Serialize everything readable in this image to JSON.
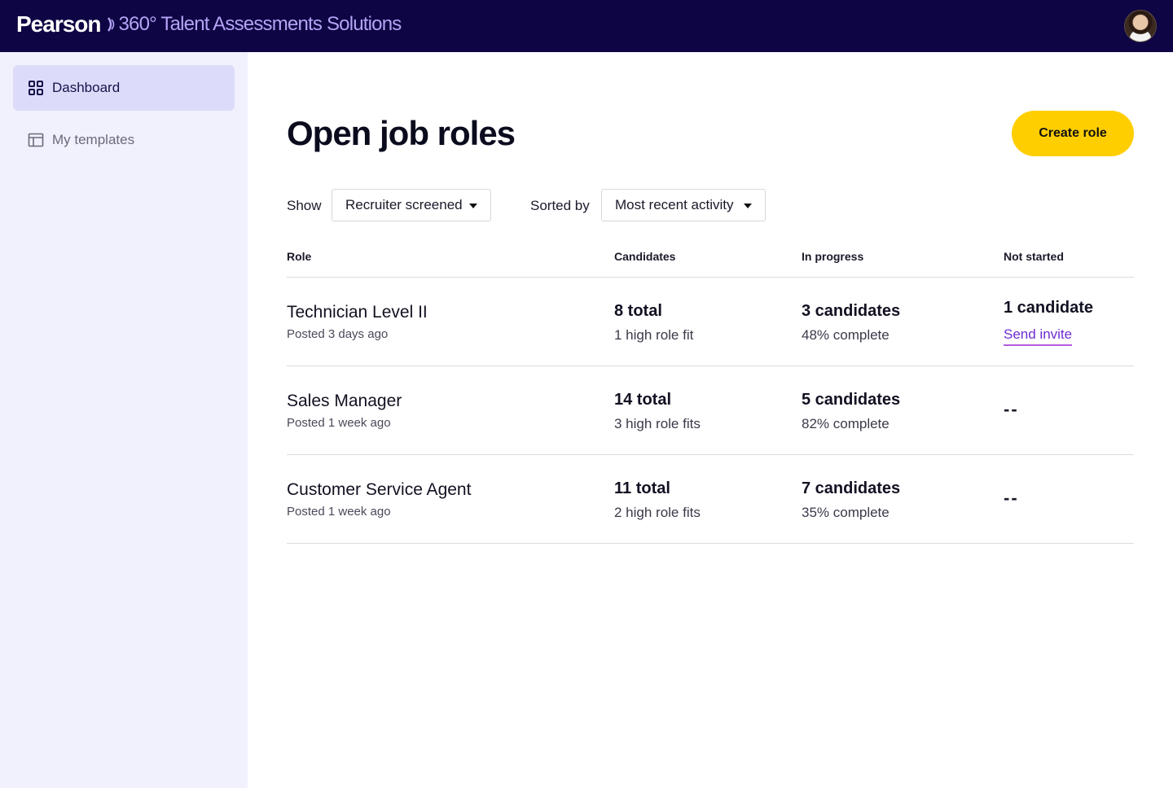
{
  "header": {
    "brand_name": "Pearson",
    "product_name": "360° Talent Assessments Solutions",
    "avatar_icon": "user-avatar"
  },
  "sidebar": {
    "items": [
      {
        "label": "Dashboard",
        "icon": "grid-icon",
        "active": true
      },
      {
        "label": "My templates",
        "icon": "template-icon",
        "active": false
      }
    ]
  },
  "main": {
    "title": "Open job roles",
    "create_button": "Create role",
    "filters": {
      "show_label": "Show",
      "show_value": "Recruiter screened",
      "sort_label": "Sorted by",
      "sort_value": "Most recent activity"
    },
    "table": {
      "headers": [
        "Role",
        "Candidates",
        "In progress",
        "Not started"
      ],
      "rows": [
        {
          "role": "Technician Level II",
          "posted": "Posted 3 days ago",
          "candidates_total": "8 total",
          "candidates_fit": "1 high role fit",
          "in_progress": "3 candidates",
          "in_progress_pct": "48% complete",
          "not_started": "1 candidate",
          "not_started_action": "Send invite"
        },
        {
          "role": "Sales Manager",
          "posted": "Posted 1 week ago",
          "candidates_total": "14 total",
          "candidates_fit": "3 high role fits",
          "in_progress": "5 candidates",
          "in_progress_pct": "82% complete",
          "not_started": "--"
        },
        {
          "role": "Customer Service Agent",
          "posted": "Posted 1 week ago",
          "candidates_total": "11 total",
          "candidates_fit": "2 high role fits",
          "in_progress": "7 candidates",
          "in_progress_pct": "35% complete",
          "not_started": "--"
        }
      ]
    }
  },
  "colors": {
    "header_bg": "#0e0544",
    "product_text": "#b4a4f5",
    "sidebar_bg": "#f1f1fe",
    "sidebar_active": "#dcdcfa",
    "cta": "#ffce00",
    "link": "#6f2cd2"
  }
}
